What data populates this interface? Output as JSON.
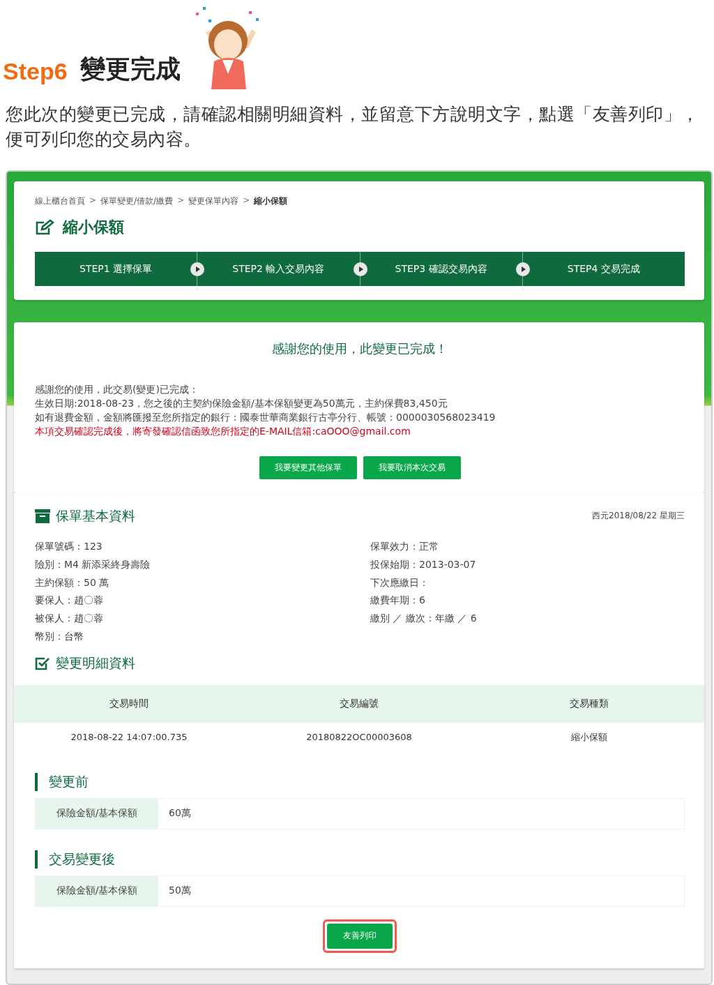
{
  "header": {
    "step": "Step6",
    "title": "變更完成"
  },
  "intro": "您此次的變更已完成，請確認相關明細資料，並留意下方說明文字，點選「友善列印」，便可列印您的交易內容。",
  "breadcrumb": [
    {
      "label": "線上櫃台首頁",
      "current": false
    },
    {
      "label": ">",
      "kind": "separator"
    },
    {
      "label": "保單變更/借款/繳費",
      "current": false
    },
    {
      "label": ">",
      "kind": "separator"
    },
    {
      "label": "變更保單內容",
      "current": false
    },
    {
      "label": ">",
      "kind": "separator"
    },
    {
      "label": "縮小保額",
      "current": true
    }
  ],
  "page_title": "縮小保額",
  "steps": [
    {
      "label": "STEP1 選擇保單",
      "done": true
    },
    {
      "label": "STEP2 輸入交易內容",
      "done": true
    },
    {
      "label": "STEP3 確認交易內容",
      "done": true
    },
    {
      "label": "STEP4 交易完成",
      "done": true
    }
  ],
  "completion": {
    "heading": "感謝您的使用，此變更已完成！",
    "lines": [
      {
        "text": "感謝您的使用，此交易(變更)已完成：",
        "kind": "normal"
      },
      {
        "text": "生效日期:2018-08-23，您之後的主契約保險金額/基本保額變更為50萬元，主約保費83,450元",
        "kind": "normal"
      },
      {
        "text": "如有退費金額，金額將匯撥至您所指定的銀行：國泰世華商業銀行古亭分行、帳號：0000030568023419",
        "kind": "normal"
      },
      {
        "text": "本項交易確認完成後，將寄發確認信函致您所指定的E-MAIL信箱:caOOO@gmail.com",
        "kind": "warning"
      }
    ],
    "buttons": [
      "我要變更其他保單",
      "我要取消本次交易"
    ]
  },
  "policy": {
    "title": "保單基本資料",
    "date": "西元2018/08/22 星期三",
    "left": [
      "保單號碼：123",
      "險別：M4 新添采終身壽險",
      "主約保額：50 萬",
      "要保人：趙〇蓉",
      "被保人：趙〇蓉",
      "幣別：台幣"
    ],
    "right": [
      "保單效力：正常",
      "投保始期：2013-03-07",
      "下次應繳日：",
      "繳費年期：6",
      "繳別 ／ 繳次：年繳 ／ 6"
    ]
  },
  "details": {
    "title": "變更明細資料",
    "columns": [
      "交易時間",
      "交易編號",
      "交易種類"
    ],
    "rows": [
      [
        "2018-08-22 14:07:00.735",
        "20180822OC00003608",
        "縮小保額"
      ]
    ]
  },
  "before": {
    "title": "變更前",
    "label": "保險金額/基本保額",
    "value": "60萬"
  },
  "after": {
    "title": "交易變更後",
    "label": "保險金額/基本保額",
    "value": "50萬"
  },
  "print_button": {
    "label": "友善列印",
    "highlighted": true
  }
}
